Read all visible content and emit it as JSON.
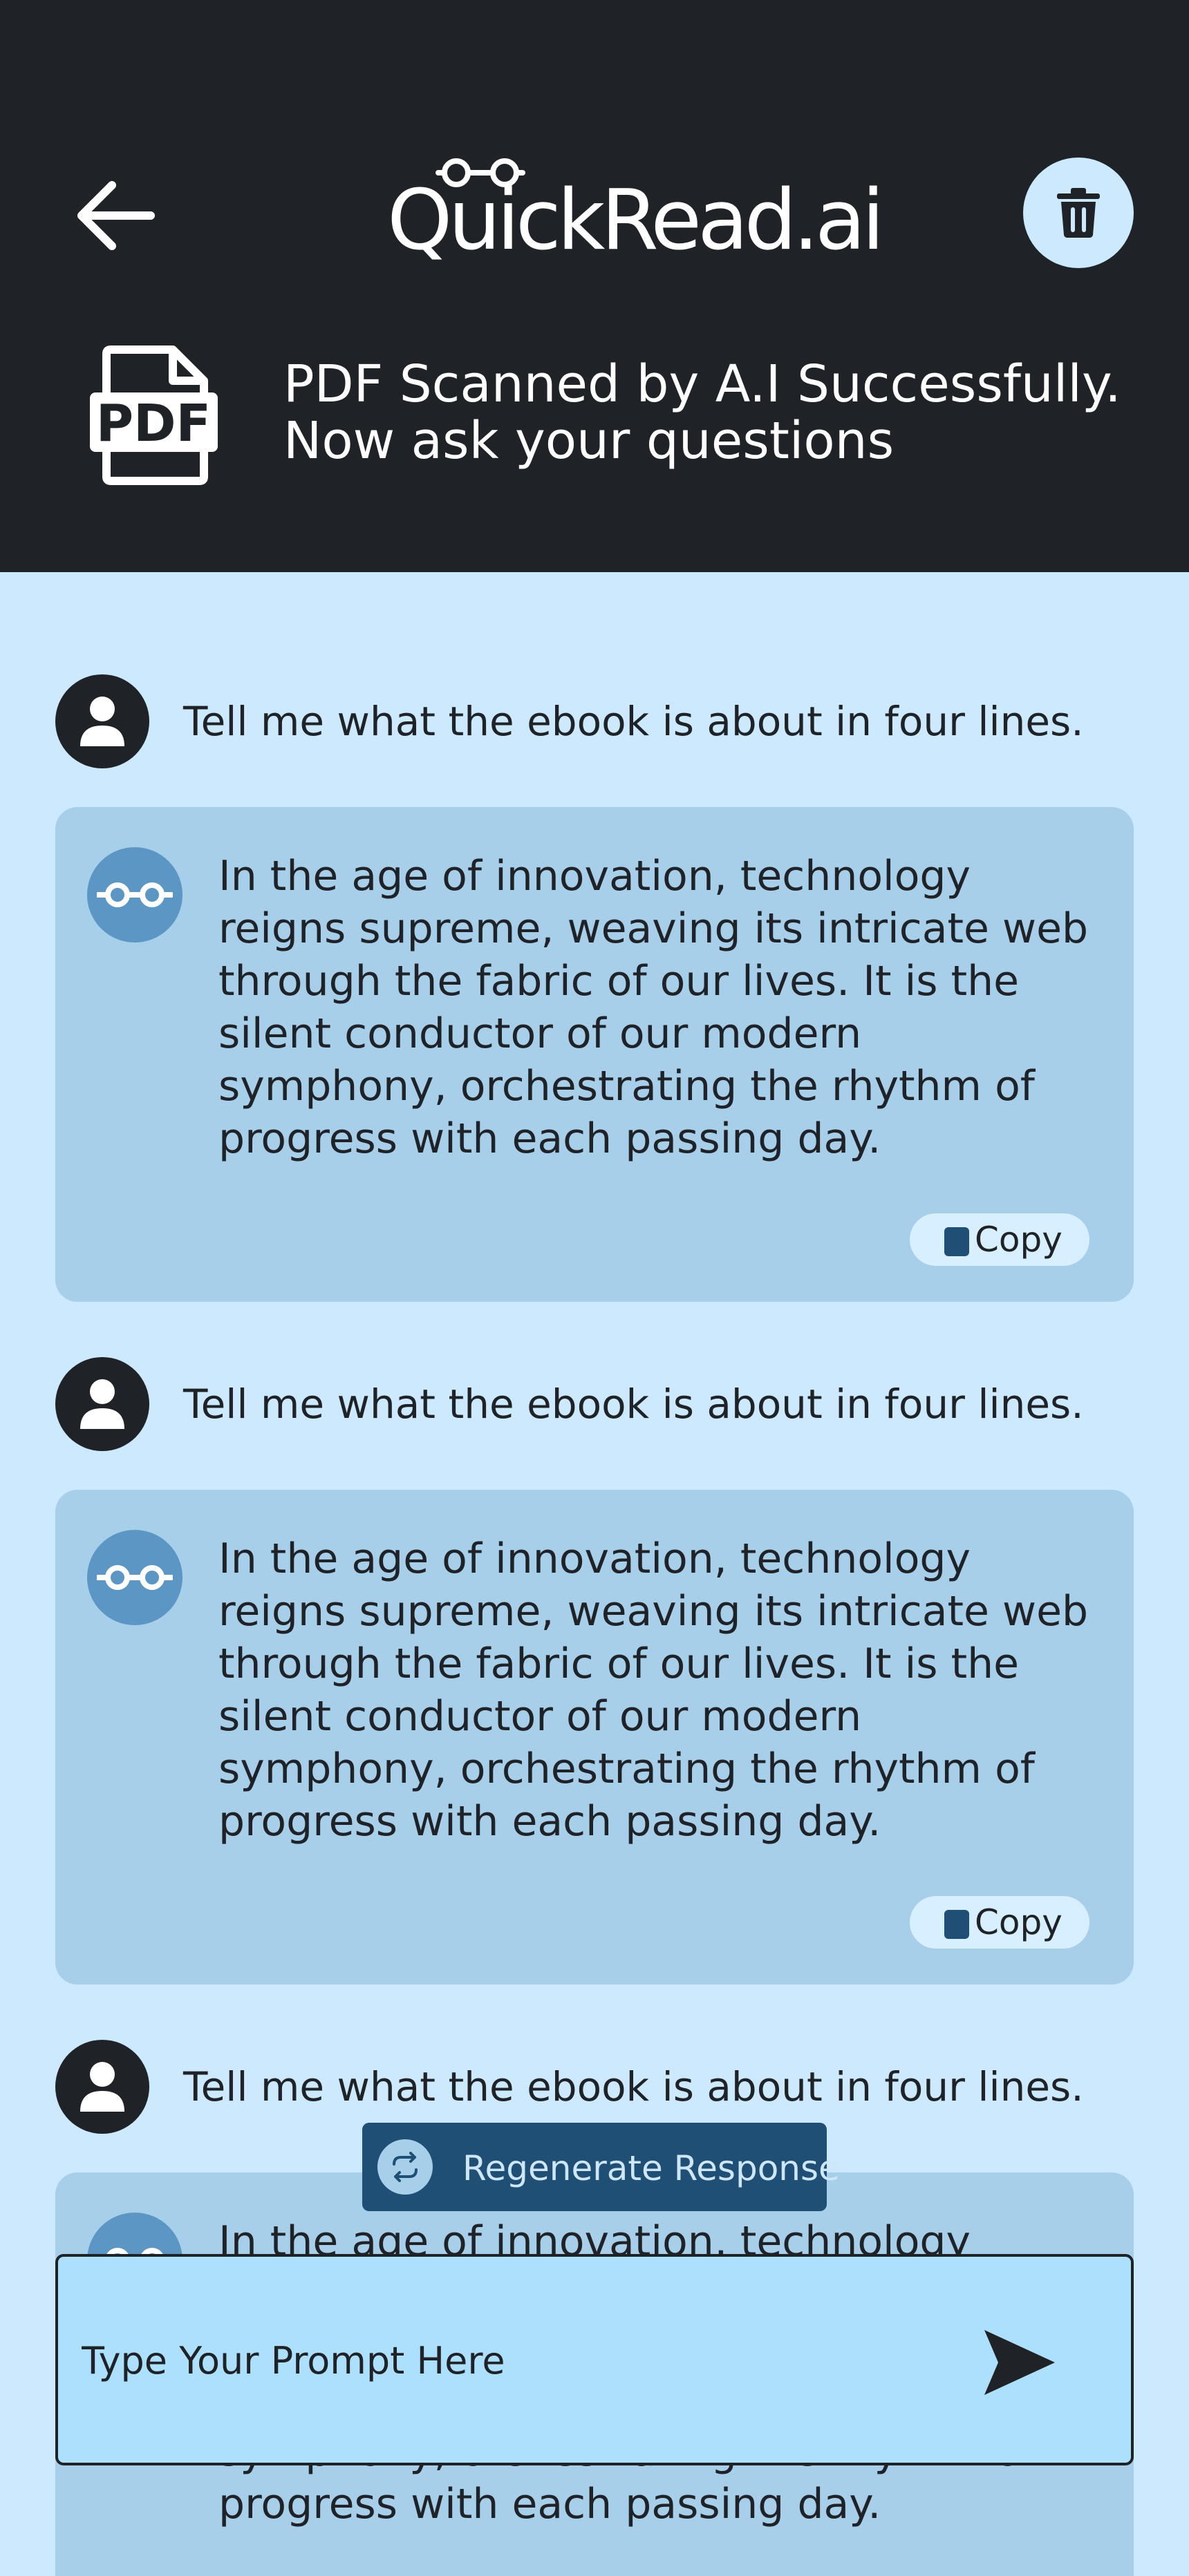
{
  "header": {
    "logo_text": "QuickRead.ai",
    "scan_message_line1": "PDF Scanned by A.I  Successfully.",
    "scan_message_line2": "Now ask your questions",
    "pdf_icon_text": "PDF"
  },
  "conversation": [
    {
      "user": "Tell me what the ebook is about in four lines.",
      "bot": "In the age of innovation, technology reigns supreme, weaving its intricate web through the fabric of our lives. It is the silent conductor of our modern symphony, orchestrating the rhythm of progress with each passing day.",
      "copy_label": "Copy"
    },
    {
      "user": "Tell me what the ebook is about in four lines.",
      "bot": "In the age of innovation, technology reigns supreme, weaving its intricate web through the fabric of our lives. It is the silent conductor of our modern symphony, orchestrating the rhythm of progress with each passing day.",
      "copy_label": "Copy"
    },
    {
      "user": "Tell me what the ebook is about in four lines.",
      "bot": "In the age of innovation, technology reigns supreme, weaving its intricate web through the fabric of our lives. It is the silent conductor of our modern symphony, orchestrating the rhythm of progress with each passing day.",
      "copy_label": "Copy"
    }
  ],
  "regenerate_label": "Regenerate Response",
  "prompt": {
    "placeholder": "Type Your Prompt Here",
    "value": ""
  },
  "colors": {
    "header_bg": "#1f2328",
    "page_bg": "#cce9fe",
    "bot_card_bg": "#a7cfea",
    "accent": "#1f4f75",
    "input_bg": "#ade0fd"
  }
}
